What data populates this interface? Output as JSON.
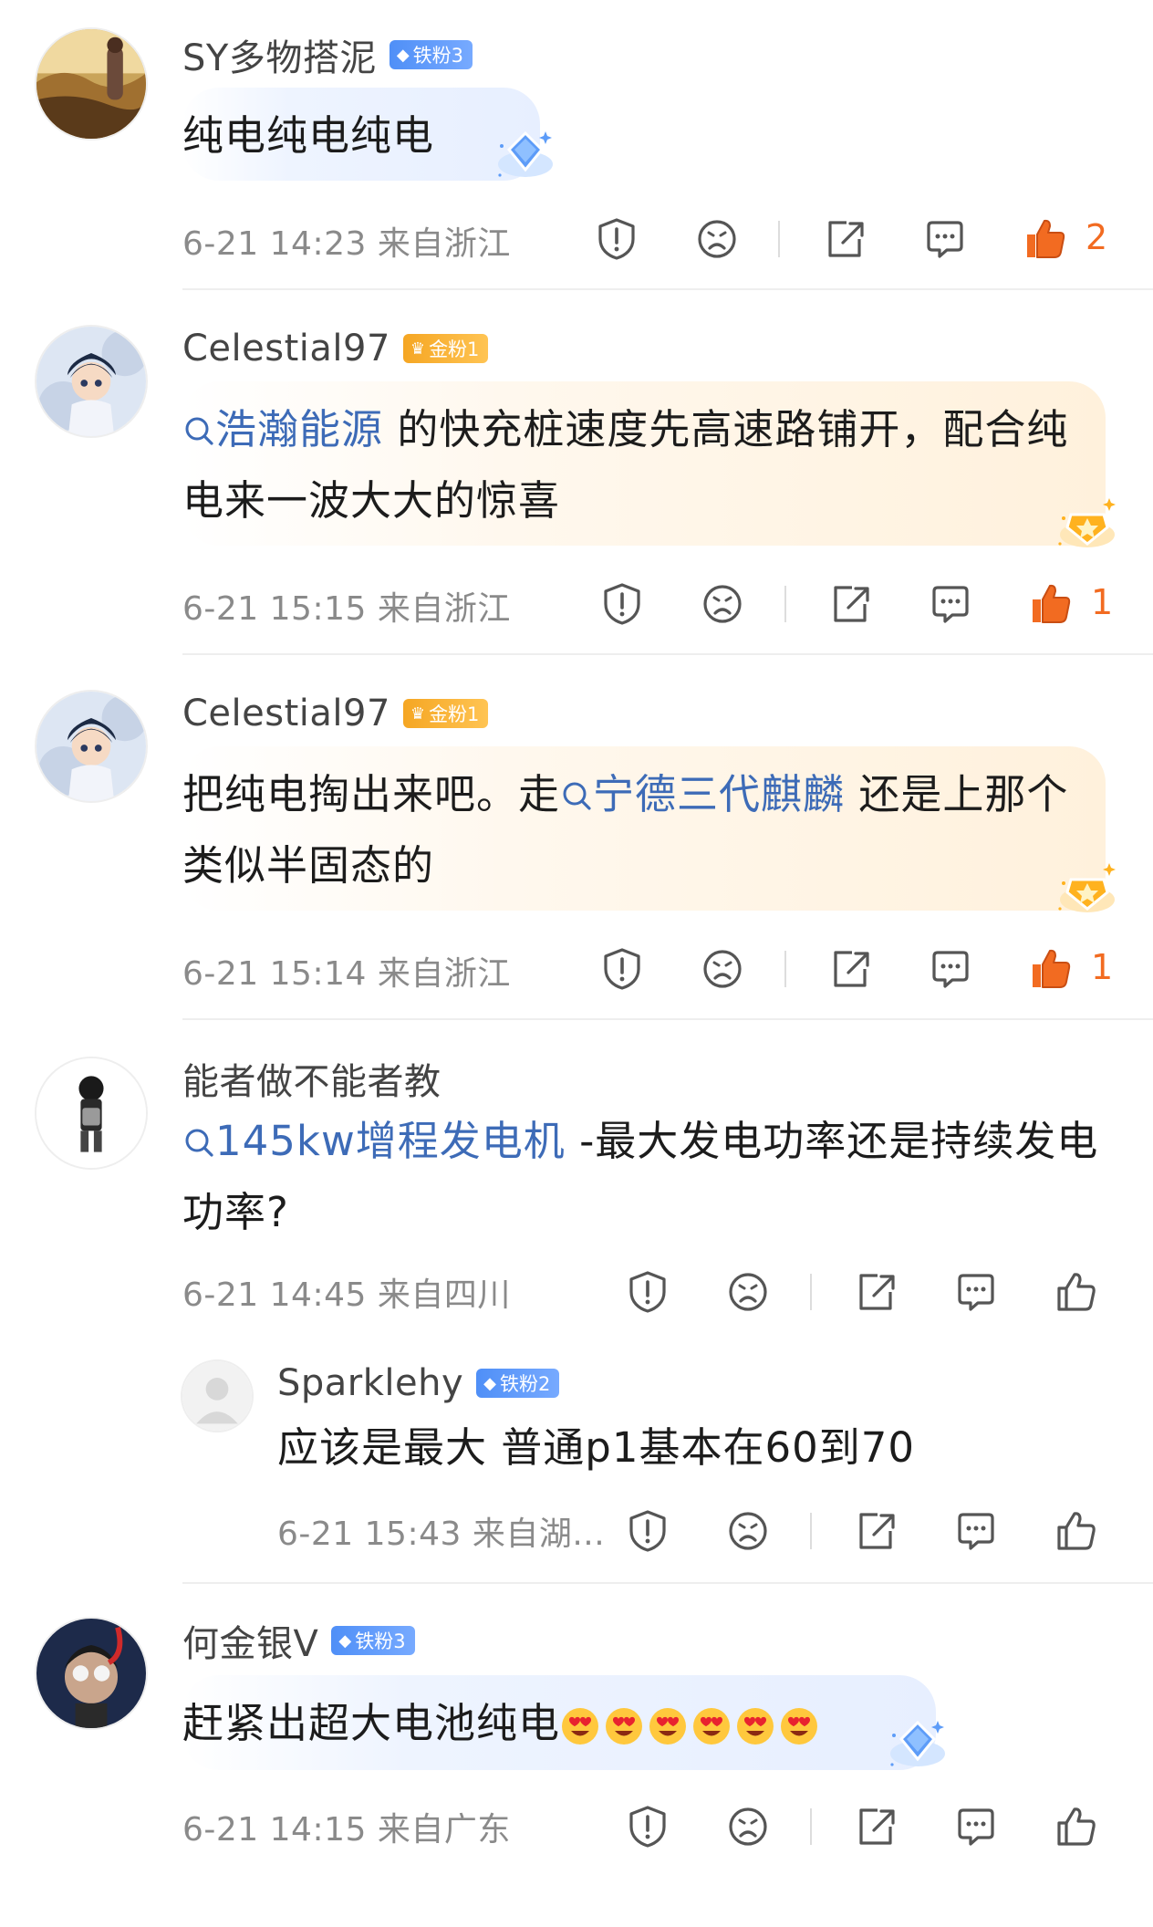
{
  "comments": [
    {
      "username": "SY多物搭泥",
      "badge": "铁粉3",
      "text": "纯电纯电纯电",
      "time": "6-21 14:23",
      "location": "来自浙江",
      "likes": "2"
    },
    {
      "username": "Celestial97",
      "badge": "金粉1",
      "topic": "浩瀚能源",
      "text_after": " 的快充桩速度先高速路铺开，配合纯电来一波大大的惊喜",
      "time": "6-21 15:15",
      "location": "来自浙江",
      "likes": "1"
    },
    {
      "username": "Celestial97",
      "badge": "金粉1",
      "text_before": "把纯电掏出来吧。走",
      "topic": "宁德三代麒麟",
      "text_after": " 还是上那个类似半固态的",
      "time": "6-21 15:14",
      "location": "来自浙江",
      "likes": "1"
    },
    {
      "username": "能者做不能者教",
      "topic": "145kw增程发电机",
      "text_after": " -最大发电功率还是持续发电功率?",
      "time": "6-21 14:45",
      "location": "来自四川"
    },
    {
      "username": "何金银V",
      "badge": "铁粉3",
      "text": "赶紧出超大电池纯电",
      "time": "6-21 14:15",
      "location": "来自广东"
    }
  ],
  "reply": {
    "username": "Sparklehy",
    "badge": "铁粉2",
    "text": "应该是最大 普通p1基本在60到70",
    "time": "6-21 15:43",
    "location": "来自湖..."
  },
  "colors": {
    "topic": "#3d6bb7",
    "like_active": "#f26b21",
    "badge_iron": "#4f8ff7",
    "badge_gold": "#f5a623"
  }
}
